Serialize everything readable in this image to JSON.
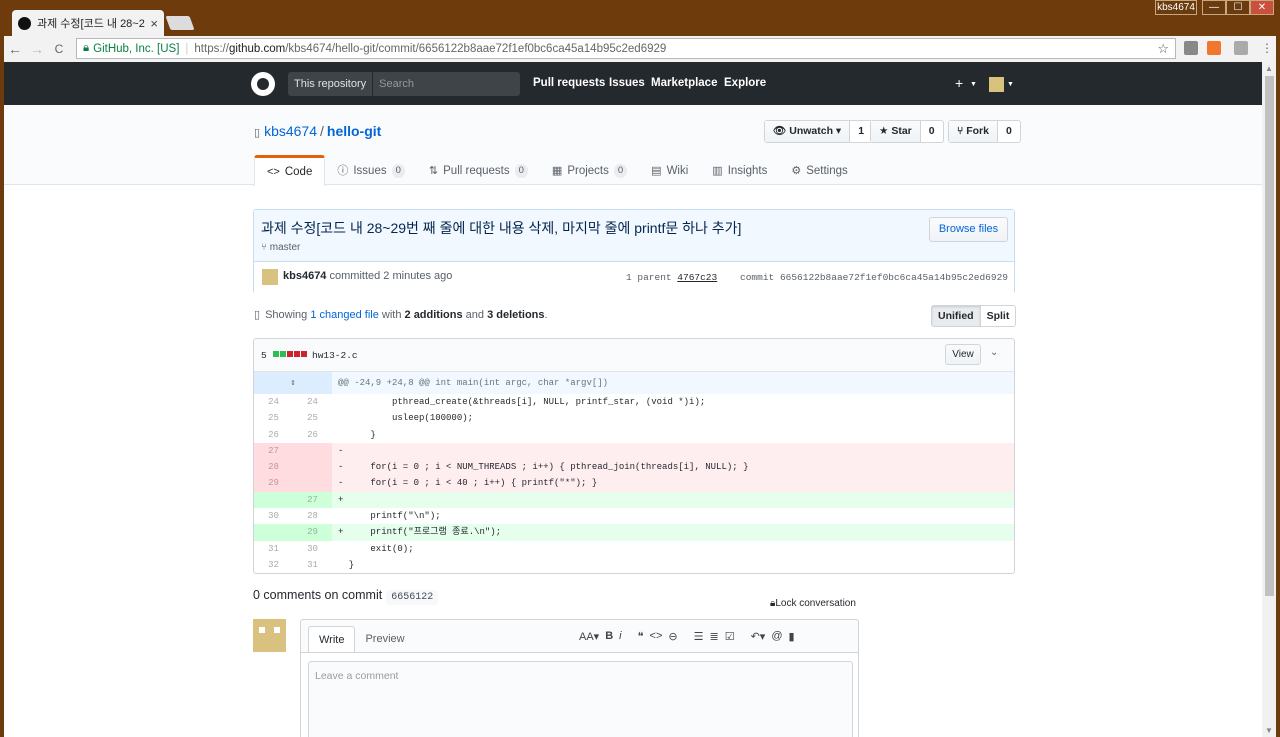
{
  "browser": {
    "tab_title": "과제 수정[코드 내 28~2",
    "tab_close": "×",
    "user_badge": "kbs4674",
    "min": "—",
    "max": "☐",
    "close": "✕",
    "nav_back": "←",
    "nav_forward": "→",
    "nav_reload": "C",
    "secure_label": "GitHub, Inc. [US]",
    "url_scheme": "https://",
    "url_domain": "github.com",
    "url_path": "/kbs4674/hello-git/commit/6656122b8aae72f1ef0bc6ca45a14b95c2ed6929",
    "bookmark": "☆"
  },
  "gh": {
    "search_scope": "This repository",
    "search_placeholder": "Search",
    "nav": [
      "Pull requests",
      "Issues",
      "Marketplace",
      "Explore"
    ],
    "plus": "+"
  },
  "repo": {
    "owner": "kbs4674",
    "sep": "/",
    "name": "hello-git",
    "watch": {
      "label": "Unwatch",
      "count": "1"
    },
    "star": {
      "label": "Star",
      "count": "0"
    },
    "fork": {
      "label": "Fork",
      "count": "0"
    },
    "tabs": [
      {
        "label": "Code",
        "icon": "<>"
      },
      {
        "label": "Issues",
        "count": "0",
        "icon": "ⓘ"
      },
      {
        "label": "Pull requests",
        "count": "0",
        "icon": "⇅"
      },
      {
        "label": "Projects",
        "count": "0",
        "icon": "▦"
      },
      {
        "label": "Wiki",
        "icon": "▤"
      },
      {
        "label": "Insights",
        "icon": "▥"
      },
      {
        "label": "Settings",
        "icon": "⚙"
      }
    ]
  },
  "commit": {
    "title": "과제 수정[코드 내 28~29번 째 줄에 대한 내용 삭제, 마지막 줄에 printf문 하나 추가]",
    "branch": "master",
    "browse": "Browse files",
    "author": "kbs4674",
    "when": "committed 2 minutes ago",
    "parent_label": "1 parent",
    "parent_sha": "4767c23",
    "commit_label": "commit",
    "sha": "6656122b8aae72f1ef0bc6ca45a14b95c2ed6929"
  },
  "toc": {
    "showing": "Showing",
    "changed": "1 changed file",
    "with": "with",
    "additions": "2 additions",
    "and": "and",
    "deletions": "3 deletions",
    "period": ".",
    "unified": "Unified",
    "split": "Split"
  },
  "file": {
    "changes": "5",
    "name": "hw13-2.c",
    "view": "View",
    "hunk": "@@ -24,9 +24,8 @@ int main(int argc, char *argv[])",
    "lines": [
      {
        "type": "ctx",
        "old": "24",
        "new": "24",
        "code": "          pthread_create(&threads[i], NULL, printf_star, (void *)i);"
      },
      {
        "type": "ctx",
        "old": "25",
        "new": "25",
        "code": "          usleep(100000);"
      },
      {
        "type": "ctx",
        "old": "26",
        "new": "26",
        "code": "      }"
      },
      {
        "type": "del",
        "old": "27",
        "new": "",
        "code": "-"
      },
      {
        "type": "del",
        "old": "28",
        "new": "",
        "code": "-     for(i = 0 ; i < NUM_THREADS ; i++) { pthread_join(threads[i], NULL); }"
      },
      {
        "type": "del",
        "old": "29",
        "new": "",
        "code": "-     for(i = 0 ; i < 40 ; i++) { printf(\"*\"); }"
      },
      {
        "type": "add",
        "old": "",
        "new": "27",
        "code": "+"
      },
      {
        "type": "ctx",
        "old": "30",
        "new": "28",
        "code": "      printf(\"\\n\");"
      },
      {
        "type": "add",
        "old": "",
        "new": "29",
        "code": "+     printf(\"프로그램 종료.\\n\");"
      },
      {
        "type": "ctx",
        "old": "31",
        "new": "30",
        "code": "      exit(0);"
      },
      {
        "type": "ctx",
        "old": "32",
        "new": "31",
        "code": "  }"
      }
    ]
  },
  "comments": {
    "heading": "0 comments on commit",
    "sha_short": "6656122",
    "lock": "Lock conversation",
    "write": "Write",
    "preview": "Preview",
    "placeholder": "Leave a comment"
  },
  "colors": {
    "add": "#2cbe4e",
    "del": "#cb2431",
    "accent": "#e36209",
    "link": "#0366d6"
  }
}
